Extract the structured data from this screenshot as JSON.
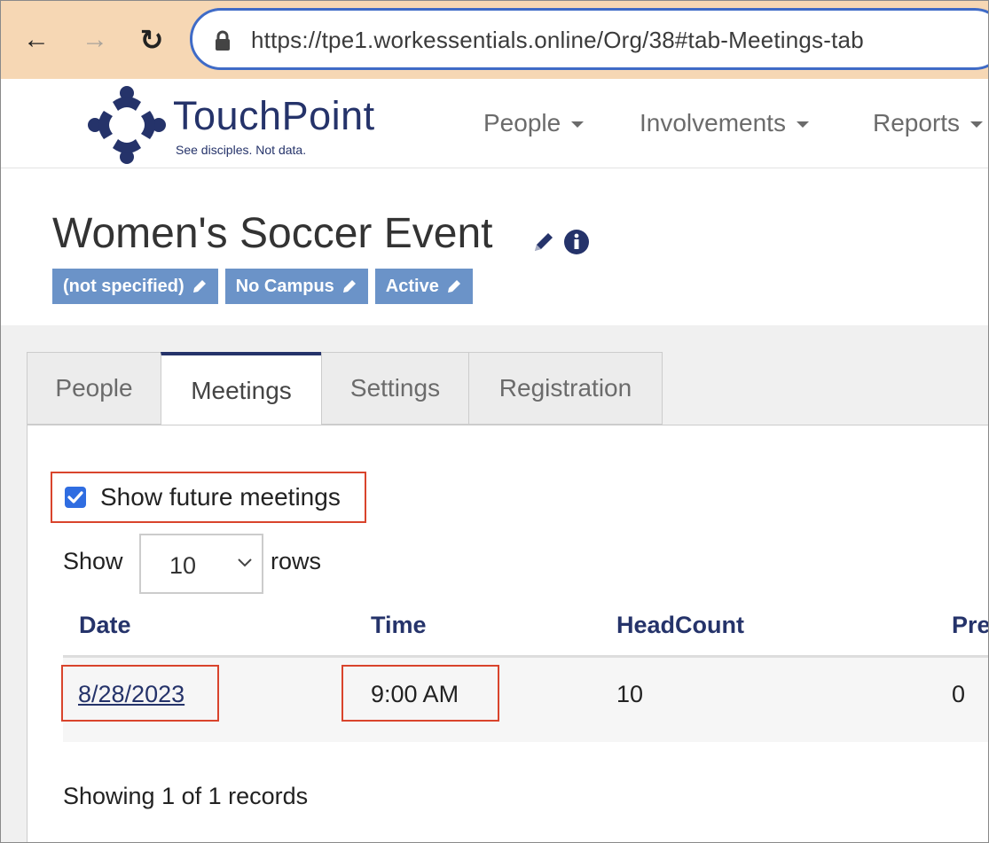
{
  "browser": {
    "url": "https://tpe1.workessentials.online/Org/38#tab-Meetings-tab",
    "back_glyph": "←",
    "forward_glyph": "→",
    "reload_glyph": "↻"
  },
  "header": {
    "logo_name": "TouchPoint",
    "logo_tagline": "See disciples. Not data.",
    "nav": [
      "People",
      "Involvements",
      "Reports"
    ]
  },
  "org": {
    "title": "Women's Soccer Event",
    "badges": [
      "(not specified)",
      "No Campus",
      "Active"
    ]
  },
  "tabs": [
    "People",
    "Meetings",
    "Settings",
    "Registration"
  ],
  "active_tab": "Meetings",
  "meetings": {
    "show_future_label": "Show future meetings",
    "show_future_checked": true,
    "show_label": "Show",
    "rows_value": "10",
    "rows_label": "rows",
    "columns": [
      "Date",
      "Time",
      "HeadCount",
      "Pre"
    ],
    "rows": [
      {
        "date": "8/28/2023",
        "time": "9:00 AM",
        "headcount": "10",
        "present": "0"
      }
    ],
    "info": "Showing 1 of 1 records"
  },
  "colors": {
    "accent": "#25336a",
    "badge": "#6b93c8",
    "highlight": "#d9442c",
    "browser_bar": "#f6d7b4"
  },
  "icons": [
    "back-arrow-icon",
    "forward-arrow-icon",
    "reload-icon",
    "lock-icon",
    "pencil-icon",
    "info-icon",
    "checkbox-icon",
    "chevron-down-icon"
  ]
}
